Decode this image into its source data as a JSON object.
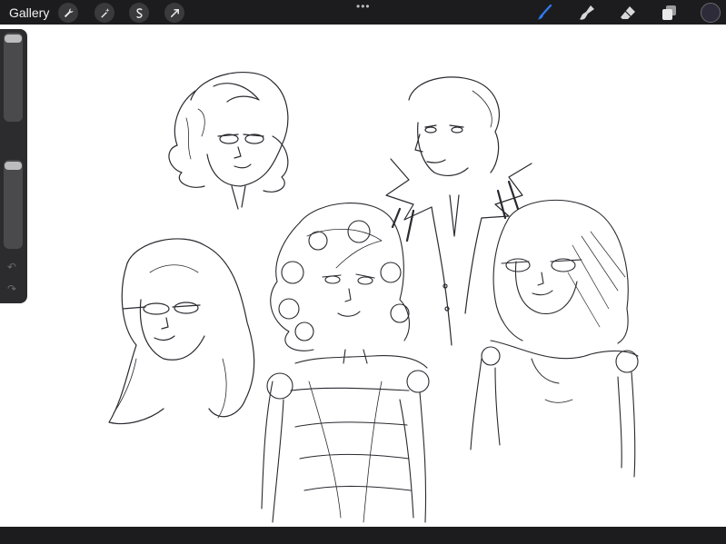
{
  "topbar": {
    "gallery_label": "Gallery",
    "tools_left": [
      "wrench-icon",
      "magic-wand-icon",
      "selection-s-icon",
      "transform-arrow-icon"
    ],
    "more_dots": "•••",
    "tools_right": [
      "brush-icon",
      "smudge-icon",
      "eraser-icon",
      "layers-icon"
    ],
    "active_tool": "brush-icon",
    "active_color": "#2d2a3a",
    "accent_color": "#2f7bf5"
  },
  "sidebar": {
    "undo_glyph": "↶",
    "redo_glyph": "↷"
  },
  "canvas": {
    "background": "#ffffff"
  }
}
